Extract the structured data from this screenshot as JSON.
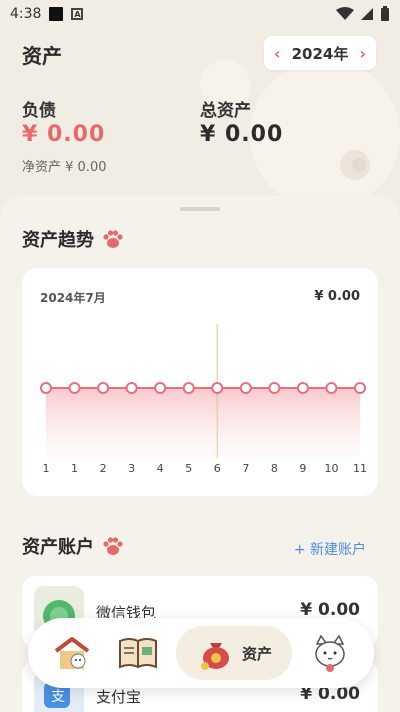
{
  "status": {
    "time": "4:38"
  },
  "header": {
    "title": "资产",
    "year": "2024年",
    "liabilities_label": "负债",
    "liabilities_value": "¥ 0.00",
    "total_label": "总资产",
    "total_value": "¥ 0.00",
    "net_assets": "净资产 ¥ 0.00"
  },
  "trend": {
    "title": "资产趋势",
    "month": "2024年7月",
    "amount": "¥ 0.00"
  },
  "chart_data": {
    "type": "area",
    "categories": [
      "1",
      "1",
      "2",
      "3",
      "4",
      "5",
      "6",
      "7",
      "8",
      "9",
      "10",
      "11"
    ],
    "values": [
      0,
      0,
      0,
      0,
      0,
      0,
      0,
      0,
      0,
      0,
      0,
      0
    ],
    "selected_index": 6,
    "series_color": "#e8707a"
  },
  "accounts": {
    "title": "资产账户",
    "new_label": "+ 新建账户",
    "items": [
      {
        "name": "微信钱包",
        "amount": "¥ 0.00",
        "icon": "wechat-wallet-icon"
      },
      {
        "name": "支付宝",
        "amount": "¥ 0.00",
        "icon": "alipay-icon"
      }
    ]
  },
  "tabbar": {
    "items": [
      {
        "icon": "home-cat-icon"
      },
      {
        "icon": "ledger-book-icon"
      },
      {
        "icon": "money-bag-icon",
        "label": "资产"
      },
      {
        "icon": "cat-mascot-icon"
      }
    ]
  },
  "colors": {
    "accent": "#e66a6a",
    "link": "#4b8ee8"
  }
}
